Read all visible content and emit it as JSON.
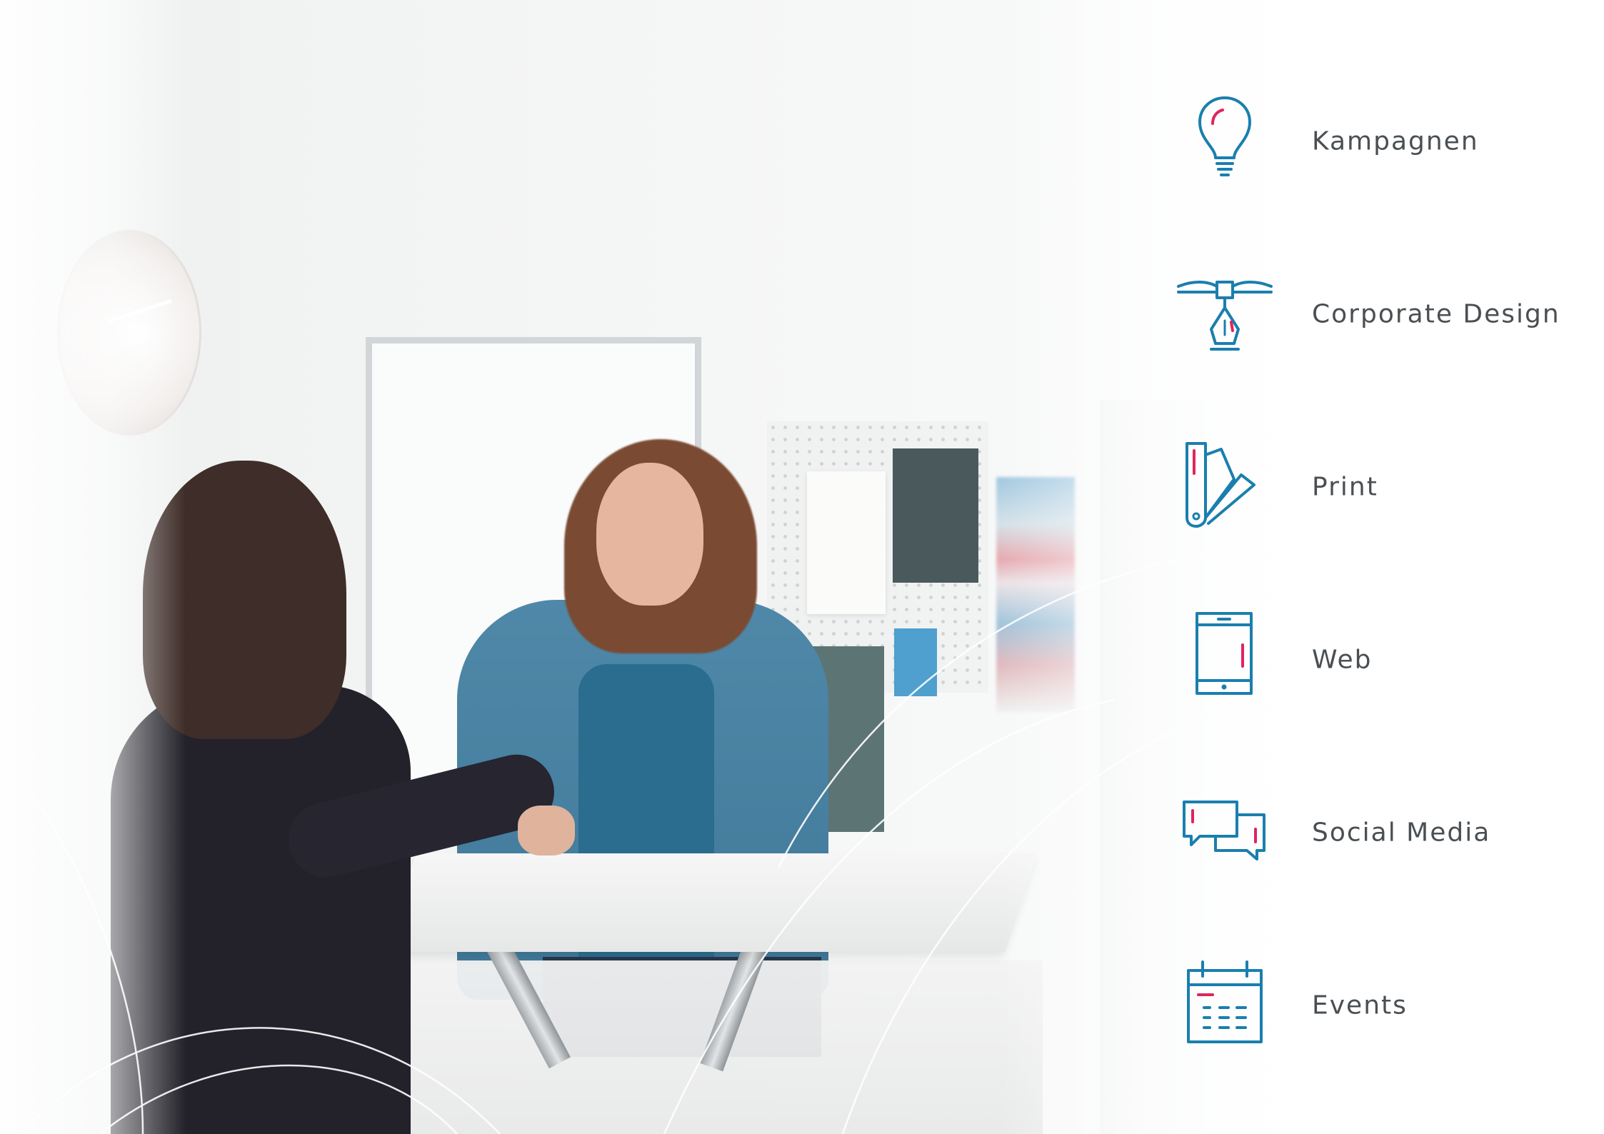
{
  "services": {
    "items": [
      {
        "label": "Kampagnen",
        "icon": "lightbulb-icon"
      },
      {
        "label": "Corporate Design",
        "icon": "pen-nib-icon"
      },
      {
        "label": "Print",
        "icon": "color-swatch-icon"
      },
      {
        "label": "Web",
        "icon": "smartphone-icon"
      },
      {
        "label": "Social Media",
        "icon": "chat-bubbles-icon"
      },
      {
        "label": "Events",
        "icon": "calendar-icon"
      }
    ]
  },
  "colors": {
    "icon_primary": "#1a7fae",
    "icon_accent": "#e0245e",
    "label_text": "#4a4f53",
    "background": "#f5f6f6"
  }
}
